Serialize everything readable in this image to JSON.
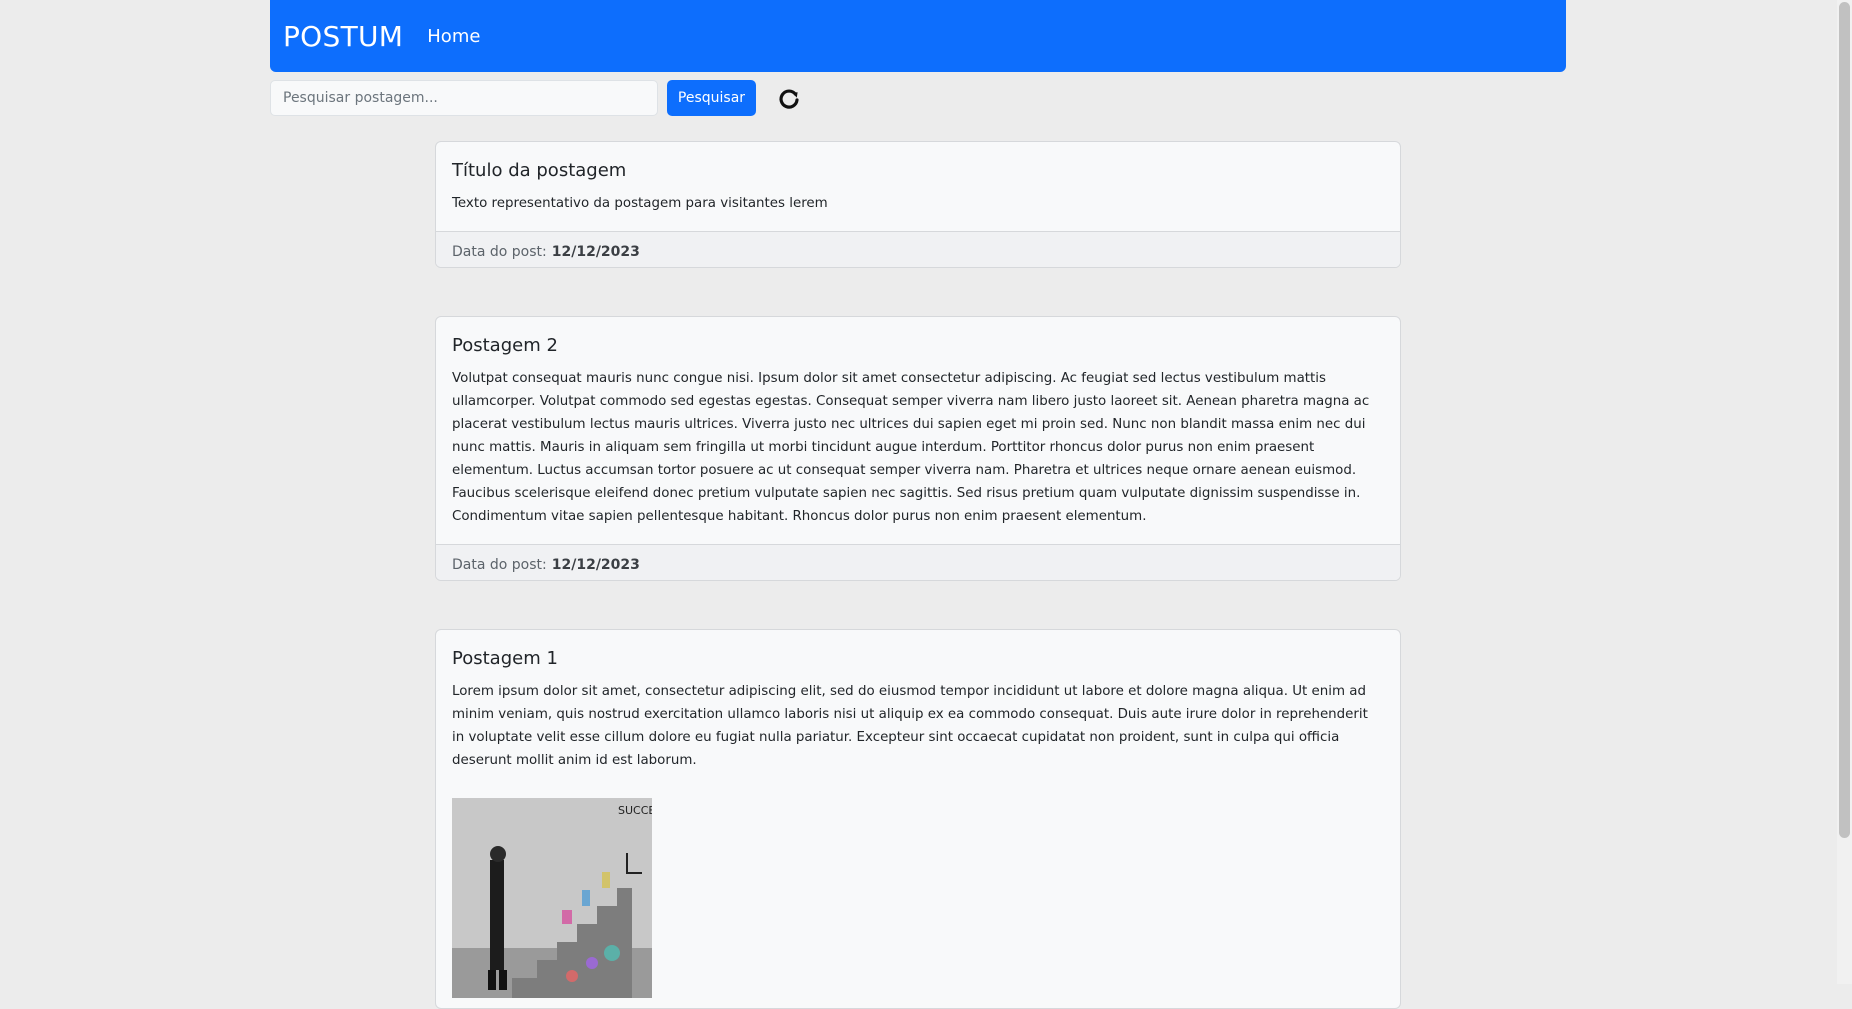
{
  "navbar": {
    "brand": "POSTUM",
    "home_link": "Home"
  },
  "search": {
    "placeholder": "Pesquisar postagem...",
    "value": "",
    "button_label": "Pesquisar"
  },
  "colors": {
    "primary": "#0d6efd",
    "page_background": "#ececec"
  },
  "posts": [
    {
      "title": "Título da postagem",
      "text": "Texto representativo da postagem para visitantes lerem",
      "date_label": "Data do post:",
      "date": "12/12/2023"
    },
    {
      "title": "Postagem 2",
      "text": "Volutpat consequat mauris nunc congue nisi. Ipsum dolor sit amet consectetur adipiscing. Ac feugiat sed lectus vestibulum mattis ullamcorper. Volutpat commodo sed egestas egestas. Consequat semper viverra nam libero justo laoreet sit. Aenean pharetra magna ac placerat vestibulum lectus mauris ultrices. Viverra justo nec ultrices dui sapien eget mi proin sed. Nunc non blandit massa enim nec dui nunc mattis. Mauris in aliquam sem fringilla ut morbi tincidunt augue interdum. Porttitor rhoncus dolor purus non enim praesent elementum. Luctus accumsan tortor posuere ac ut consequat semper viverra nam. Pharetra et ultrices neque ornare aenean euismod. Faucibus scelerisque eleifend donec pretium vulputate sapien nec sagittis. Sed risus pretium quam vulputate dignissim suspendisse in. Condimentum vitae sapien pellentesque habitant. Rhoncus dolor purus non enim praesent elementum.",
      "date_label": "Data do post:",
      "date": "12/12/2023"
    },
    {
      "title": "Postagem 1",
      "text": "Lorem ipsum dolor sit amet, consectetur adipiscing elit, sed do eiusmod tempor incididunt ut labore et dolore magna aliqua. Ut enim ad minim veniam, quis nostrud exercitation ullamco laboris nisi ut aliquip ex ea commodo consequat. Duis aute irure dolor in reprehenderit in voluptate velit esse cillum dolore eu fugiat nulla pariatur. Excepteur sint occaecat cupidatat non proident, sunt in culpa qui officia deserunt mollit anim id est laborum.",
      "image_caption": "SUCCESS"
    }
  ],
  "icons": {
    "refresh": "refresh-icon"
  }
}
